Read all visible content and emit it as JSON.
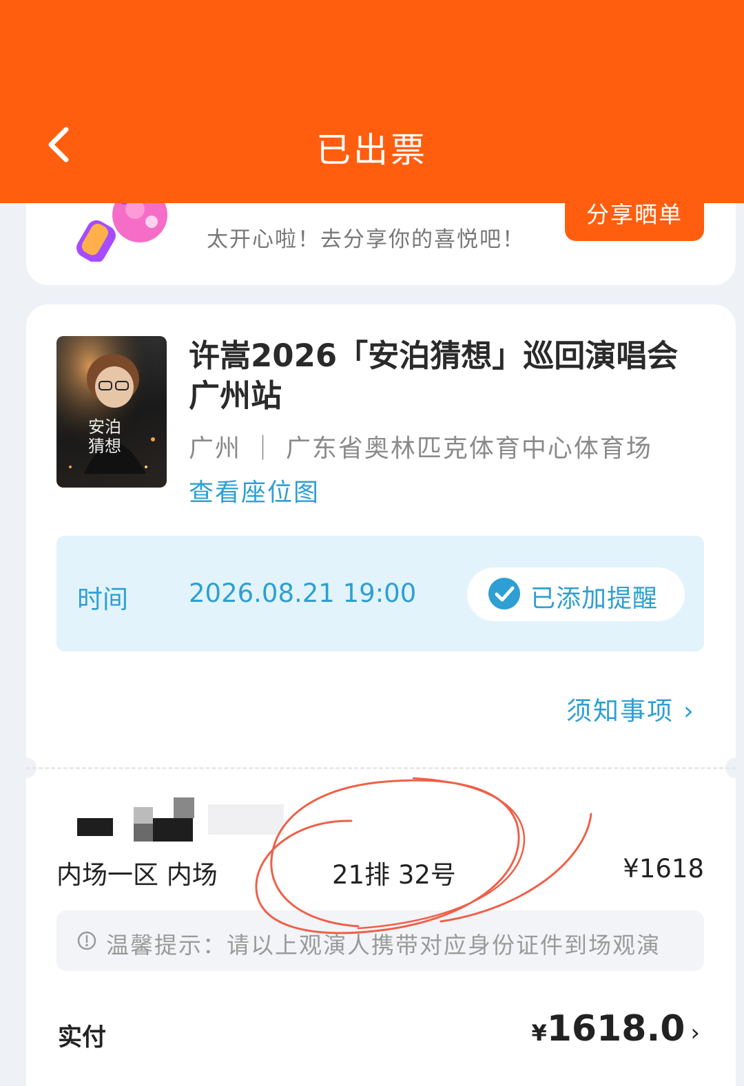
{
  "header": {
    "title": "已出票",
    "background_color": "#ff5e0f"
  },
  "share_card": {
    "subtitle": "太开心啦！去分享你的喜悦吧！",
    "share_button_label": "分享晒单"
  },
  "event": {
    "title": "许嵩2026「安泊猜想」巡回演唱会 广州站",
    "venue": "广州 ｜ 广东省奥林匹克体育中心体育场",
    "seat_map_link": "查看座位图",
    "poster_text": "安泊猜想"
  },
  "time": {
    "label": "时间",
    "value": "2026.08.21 19:00",
    "reminder_label": "已添加提醒"
  },
  "notice_link": "须知事项",
  "ticket": {
    "zone": "内场一区 内场",
    "seat": "21排 32号",
    "price": "¥1618"
  },
  "tip": "温馨提示：请以上观演人携带对应身份证件到场观演",
  "payment": {
    "label": "实付",
    "currency": "¥",
    "amount": "1618.0"
  },
  "accent_color": "#2d9fd2"
}
